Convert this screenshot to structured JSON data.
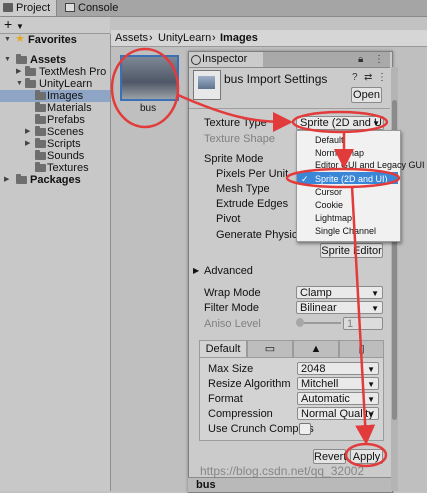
{
  "tabs": {
    "project": "Project",
    "console": "Console"
  },
  "project_toolbar": {
    "add": "+",
    "add_caret": "▼"
  },
  "tree": {
    "favorites": "Favorites",
    "assets": "Assets",
    "textmesh_pro": "TextMesh Pro",
    "unitylearn": "UnityLearn",
    "images": "Images",
    "materials": "Materials",
    "prefabs": "Prefabs",
    "scenes": "Scenes",
    "scripts": "Scripts",
    "sounds": "Sounds",
    "textures": "Textures",
    "packages": "Packages"
  },
  "breadcrumb": {
    "a": "Assets",
    "sep1": "›",
    "b": "UnityLearn",
    "sep2": "›",
    "c": "Images"
  },
  "asset": {
    "name": "bus"
  },
  "inspector": {
    "tab": "Inspector",
    "title": "bus Import Settings",
    "open_button": "Open",
    "texture_type_label": "Texture Type",
    "texture_type_value": "Sprite (2D and UI)",
    "texture_shape_label": "Texture Shape",
    "sprite_mode_label": "Sprite Mode",
    "pixels_per_unit_label": "Pixels Per Unit",
    "mesh_type_label": "Mesh Type",
    "extrude_edges_label": "Extrude Edges",
    "pivot_label": "Pivot",
    "generate_physics_label": "Generate Physics",
    "sprite_editor_button": "Sprite Editor",
    "advanced_label": "Advanced",
    "wrap_mode_label": "Wrap Mode",
    "wrap_mode_value": "Clamp",
    "filter_mode_label": "Filter Mode",
    "filter_mode_value": "Bilinear",
    "aniso_level_label": "Aniso Level",
    "aniso_level_value": "1",
    "aniso_level_fraction": 0.0,
    "platform_tab_default": "Default",
    "max_size_label": "Max Size",
    "max_size_value": "2048",
    "resize_algorithm_label": "Resize Algorithm",
    "resize_algorithm_value": "Mitchell",
    "format_label": "Format",
    "format_value": "Automatic",
    "compression_label": "Compression",
    "compression_value": "Normal Quality",
    "crunch_label": "Use Crunch Compres",
    "crunch_checked": false,
    "revert_button": "Revert",
    "apply_button": "Apply",
    "footer_name": "bus"
  },
  "dropdown": {
    "items": [
      "Default",
      "Normal map",
      "Editor GUI and Legacy GUI",
      "Sprite (2D and UI)",
      "Cursor",
      "Cookie",
      "Lightmap",
      "Single Channel"
    ],
    "selected_index": 3,
    "check": "✓"
  },
  "watermark": "https://blog.csdn.net/qq_32002"
}
